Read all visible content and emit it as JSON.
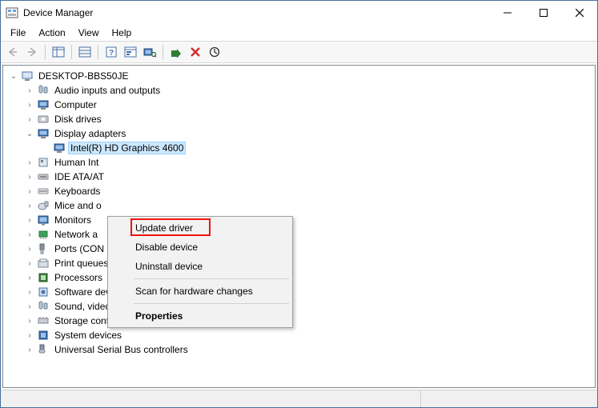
{
  "window": {
    "title": "Device Manager"
  },
  "menu": {
    "file": "File",
    "action": "Action",
    "view": "View",
    "help": "Help"
  },
  "tree": {
    "root": "DESKTOP-BBS50JE",
    "items": [
      {
        "label": "Audio inputs and outputs"
      },
      {
        "label": "Computer"
      },
      {
        "label": "Disk drives"
      },
      {
        "label": "Display adapters",
        "expanded": true,
        "child": "Intel(R) HD Graphics 4600"
      },
      {
        "label": "Human Int"
      },
      {
        "label": "IDE ATA/AT"
      },
      {
        "label": "Keyboards"
      },
      {
        "label": "Mice and o"
      },
      {
        "label": "Monitors"
      },
      {
        "label": "Network a"
      },
      {
        "label": "Ports (CON"
      },
      {
        "label": "Print queues"
      },
      {
        "label": "Processors"
      },
      {
        "label": "Software devices"
      },
      {
        "label": "Sound, video and game controllers"
      },
      {
        "label": "Storage controllers"
      },
      {
        "label": "System devices"
      },
      {
        "label": "Universal Serial Bus controllers"
      }
    ]
  },
  "context_menu": {
    "update": "Update driver",
    "disable": "Disable device",
    "uninstall": "Uninstall device",
    "scan": "Scan for hardware changes",
    "properties": "Properties"
  }
}
